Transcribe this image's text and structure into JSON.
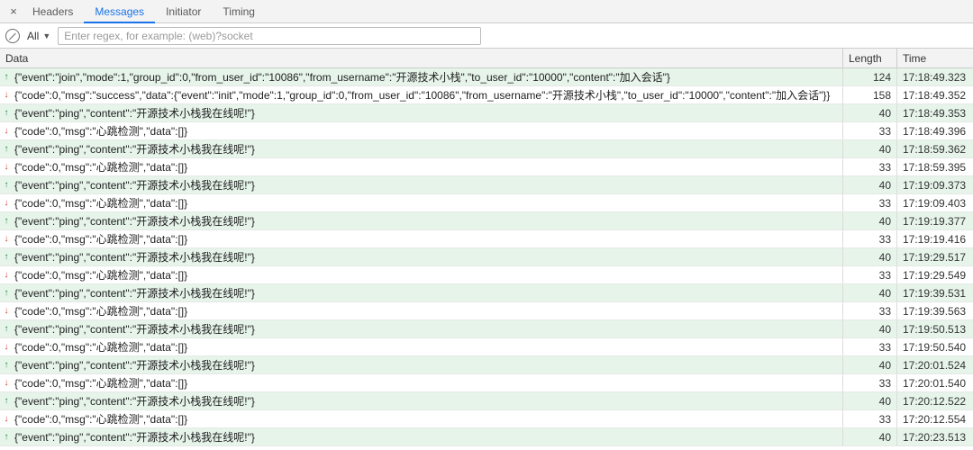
{
  "tabs": {
    "headers": "Headers",
    "messages": "Messages",
    "initiator": "Initiator",
    "timing": "Timing"
  },
  "filter": {
    "all_label": "All",
    "regex_placeholder": "Enter regex, for example: (web)?socket"
  },
  "columns": {
    "data": "Data",
    "length": "Length",
    "time": "Time"
  },
  "rows": [
    {
      "dir": "send",
      "data": "{\"event\":\"join\",\"mode\":1,\"group_id\":0,\"from_user_id\":\"10086\",\"from_username\":\"开源技术小栈\",\"to_user_id\":\"10000\",\"content\":\"加入会话\"}",
      "length": 124,
      "time": "17:18:49.323"
    },
    {
      "dir": "recv",
      "data": "{\"code\":0,\"msg\":\"success\",\"data\":{\"event\":\"init\",\"mode\":1,\"group_id\":0,\"from_user_id\":\"10086\",\"from_username\":\"开源技术小栈\",\"to_user_id\":\"10000\",\"content\":\"加入会话\"}}",
      "length": 158,
      "time": "17:18:49.352"
    },
    {
      "dir": "send",
      "data": "{\"event\":\"ping\",\"content\":\"开源技术小栈我在线呢!\"}",
      "length": 40,
      "time": "17:18:49.353"
    },
    {
      "dir": "recv",
      "data": "{\"code\":0,\"msg\":\"心跳检测\",\"data\":[]}",
      "length": 33,
      "time": "17:18:49.396"
    },
    {
      "dir": "send",
      "data": "{\"event\":\"ping\",\"content\":\"开源技术小栈我在线呢!\"}",
      "length": 40,
      "time": "17:18:59.362"
    },
    {
      "dir": "recv",
      "data": "{\"code\":0,\"msg\":\"心跳检测\",\"data\":[]}",
      "length": 33,
      "time": "17:18:59.395"
    },
    {
      "dir": "send",
      "data": "{\"event\":\"ping\",\"content\":\"开源技术小栈我在线呢!\"}",
      "length": 40,
      "time": "17:19:09.373"
    },
    {
      "dir": "recv",
      "data": "{\"code\":0,\"msg\":\"心跳检测\",\"data\":[]}",
      "length": 33,
      "time": "17:19:09.403"
    },
    {
      "dir": "send",
      "data": "{\"event\":\"ping\",\"content\":\"开源技术小栈我在线呢!\"}",
      "length": 40,
      "time": "17:19:19.377"
    },
    {
      "dir": "recv",
      "data": "{\"code\":0,\"msg\":\"心跳检测\",\"data\":[]}",
      "length": 33,
      "time": "17:19:19.416"
    },
    {
      "dir": "send",
      "data": "{\"event\":\"ping\",\"content\":\"开源技术小栈我在线呢!\"}",
      "length": 40,
      "time": "17:19:29.517"
    },
    {
      "dir": "recv",
      "data": "{\"code\":0,\"msg\":\"心跳检测\",\"data\":[]}",
      "length": 33,
      "time": "17:19:29.549"
    },
    {
      "dir": "send",
      "data": "{\"event\":\"ping\",\"content\":\"开源技术小栈我在线呢!\"}",
      "length": 40,
      "time": "17:19:39.531"
    },
    {
      "dir": "recv",
      "data": "{\"code\":0,\"msg\":\"心跳检测\",\"data\":[]}",
      "length": 33,
      "time": "17:19:39.563"
    },
    {
      "dir": "send",
      "data": "{\"event\":\"ping\",\"content\":\"开源技术小栈我在线呢!\"}",
      "length": 40,
      "time": "17:19:50.513"
    },
    {
      "dir": "recv",
      "data": "{\"code\":0,\"msg\":\"心跳检测\",\"data\":[]}",
      "length": 33,
      "time": "17:19:50.540"
    },
    {
      "dir": "send",
      "data": "{\"event\":\"ping\",\"content\":\"开源技术小栈我在线呢!\"}",
      "length": 40,
      "time": "17:20:01.524"
    },
    {
      "dir": "recv",
      "data": "{\"code\":0,\"msg\":\"心跳检测\",\"data\":[]}",
      "length": 33,
      "time": "17:20:01.540"
    },
    {
      "dir": "send",
      "data": "{\"event\":\"ping\",\"content\":\"开源技术小栈我在线呢!\"}",
      "length": 40,
      "time": "17:20:12.522"
    },
    {
      "dir": "recv",
      "data": "{\"code\":0,\"msg\":\"心跳检测\",\"data\":[]}",
      "length": 33,
      "time": "17:20:12.554"
    },
    {
      "dir": "send",
      "data": "{\"event\":\"ping\",\"content\":\"开源技术小栈我在线呢!\"}",
      "length": 40,
      "time": "17:20:23.513"
    }
  ]
}
